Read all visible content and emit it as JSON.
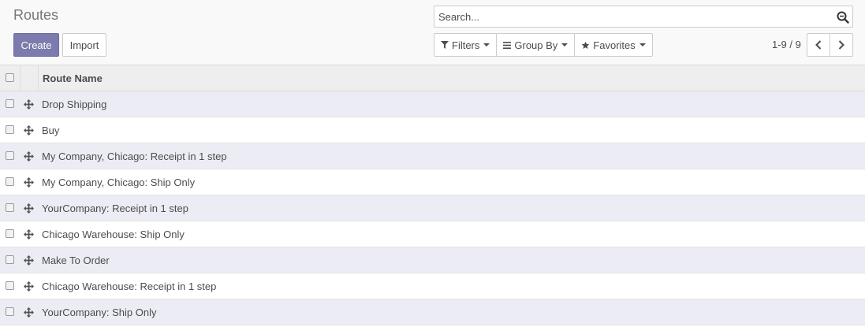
{
  "control_panel": {
    "title": "Routes",
    "create_label": "Create",
    "import_label": "Import",
    "search_placeholder": "Search...",
    "filters_label": "Filters",
    "groupby_label": "Group By",
    "favorites_label": "Favorites",
    "pager_value": "1-9 / 9"
  },
  "list": {
    "column_header": "Route Name",
    "rows": [
      {
        "name": "Drop Shipping"
      },
      {
        "name": "Buy"
      },
      {
        "name": "My Company, Chicago: Receipt in 1 step"
      },
      {
        "name": "My Company, Chicago: Ship Only"
      },
      {
        "name": "YourCompany: Receipt in 1 step"
      },
      {
        "name": "Chicago Warehouse: Ship Only"
      },
      {
        "name": "Make To Order"
      },
      {
        "name": "Chicago Warehouse: Receipt in 1 step"
      },
      {
        "name": "YourCompany: Ship Only"
      }
    ]
  },
  "colors": {
    "primary": "#7c7bad",
    "row_stripe": "#ececf5",
    "header_bg": "#eeeeee"
  },
  "icons": {
    "search": "magnifier-icon",
    "filter": "funnel-icon",
    "groupby": "bars-icon",
    "favorites": "star-icon",
    "drag": "move-arrows-icon"
  }
}
